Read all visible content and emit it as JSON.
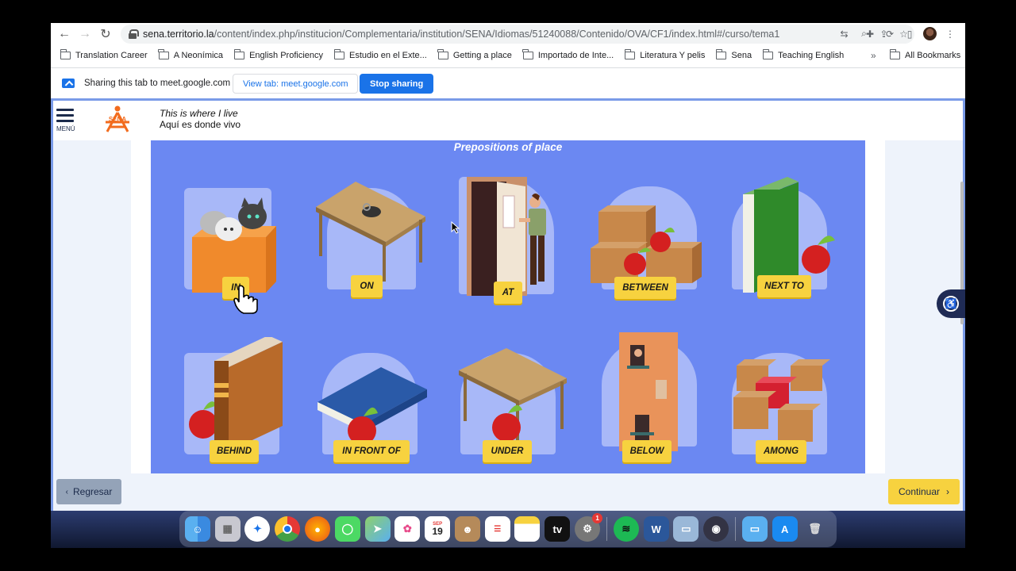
{
  "browser": {
    "url_host": "sena.territorio.la",
    "url_path": "/content/index.php/institucion/Complementaria/institution/SENA/Idiomas/51240088/Contenido/OVA/CF1/index.html#/curso/tema1",
    "bookmarks": [
      "Translation Career",
      "A Neonímica",
      "English Proficiency",
      "Estudio en el Exte...",
      "Getting a place",
      "Importado de Inte...",
      "Literatura Y pelis",
      "Sena",
      "Teaching English"
    ],
    "bookmarks_more": "»",
    "all_bookmarks": "All Bookmarks"
  },
  "share_bar": {
    "text": "Sharing this tab to meet.google.com",
    "view_tab": "View tab: meet.google.com",
    "stop": "Stop sharing"
  },
  "app": {
    "menu_label": "MENÚ",
    "logo_text": "SENA",
    "title_en": "This is where I live",
    "title_es": "Aquí es donde vivo",
    "panel_title": "Prepositions of place",
    "prepositions": [
      "IN",
      "ON",
      "AT",
      "BETWEEN",
      "NEXT TO",
      "BEHIND",
      "IN FRONT OF",
      "UNDER",
      "BELOW",
      "AMONG"
    ],
    "back_label": "Regresar",
    "next_label": "Continuar"
  },
  "dock": {
    "calendar_month": "SEP",
    "calendar_day": "19",
    "settings_badge": "1",
    "appletv_label": "tv"
  },
  "colors": {
    "panel": "#6b88f2",
    "label": "#f7d23f",
    "chrome_blue": "#1a73e8"
  }
}
